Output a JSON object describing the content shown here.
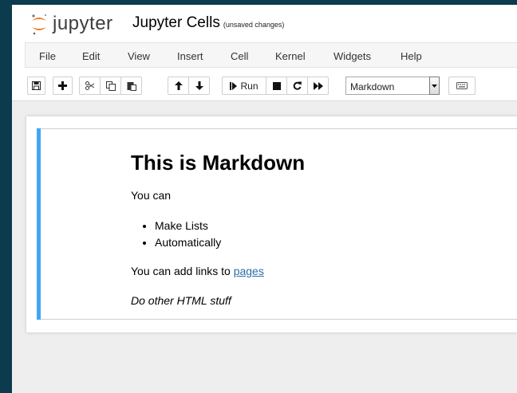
{
  "header": {
    "logo_text": "jupyter",
    "notebook_name": "Jupyter Cells",
    "save_status": "(unsaved changes)"
  },
  "menu": [
    "File",
    "Edit",
    "View",
    "Insert",
    "Cell",
    "Kernel",
    "Widgets",
    "Help"
  ],
  "toolbar": {
    "run_label": "Run",
    "cell_type": "Markdown",
    "icons": [
      "save-icon",
      "plus-icon",
      "cut-icon",
      "copy-icon",
      "paste-icon",
      "arrow-up-icon",
      "arrow-down-icon",
      "step-forward-icon",
      "stop-icon",
      "restart-icon",
      "fast-forward-icon",
      "keyboard-icon"
    ]
  },
  "cell": {
    "heading": "This is Markdown",
    "para1": "You can",
    "list": [
      "Make Lists",
      "Automatically"
    ],
    "para2_prefix": "You can add links to ",
    "link_text": "pages",
    "para3": "Do other HTML stuff"
  },
  "colors": {
    "background": "#0c3b4d",
    "selected_cell_bar": "#42a5f5",
    "link": "#296eaa",
    "logo_orange": "#f37726"
  }
}
